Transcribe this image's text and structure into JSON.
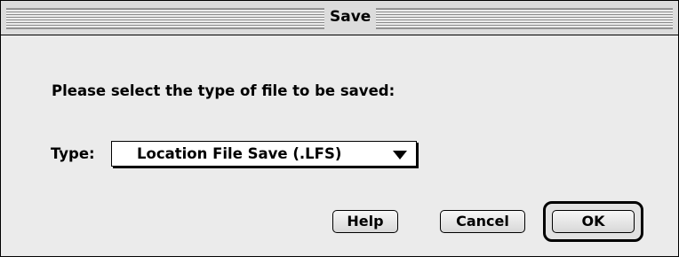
{
  "dialog": {
    "title": "Save",
    "prompt": "Please select the type of file to be saved:",
    "type_label": "Type:",
    "type_select": {
      "selected": "Location File Save (.LFS)",
      "arrow_icon": "triangle-down-icon"
    },
    "buttons": {
      "help": "Help",
      "cancel": "Cancel",
      "ok": "OK"
    },
    "default_button": "OK"
  }
}
